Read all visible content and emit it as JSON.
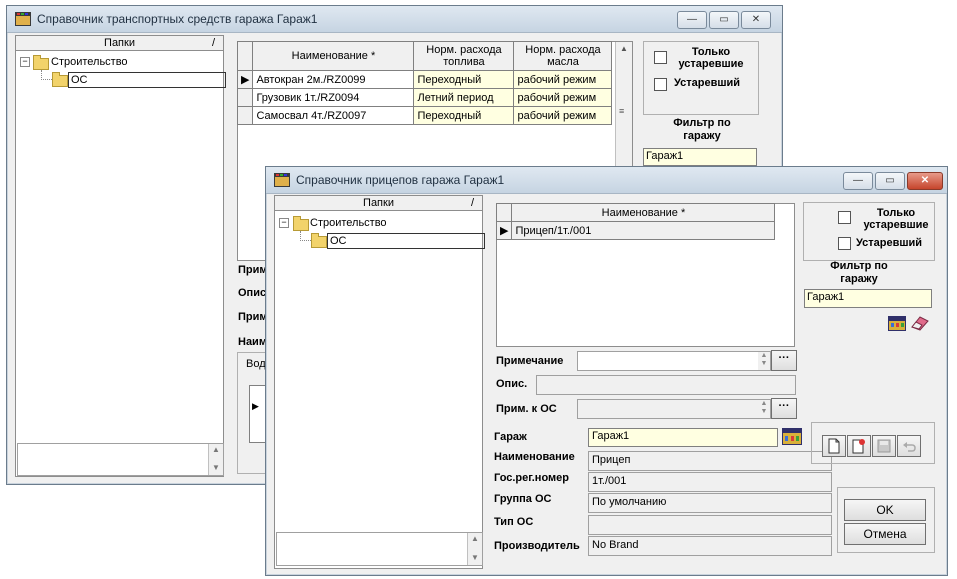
{
  "back_window": {
    "title": "Справочник транспортных средств гаража Гараж1",
    "folders_header": "Папки",
    "tree_root": "Строительство",
    "tree_child": "ОС",
    "columns": [
      "Наименование *",
      "Норм. расхода топлива",
      "Норм. расхода масла"
    ],
    "rows": [
      {
        "name": "Автокран 2м./RZ0099",
        "fuel": "Переходный",
        "oil": "рабочий режим",
        "current": true
      },
      {
        "name": "Грузовик 1т./RZ0094",
        "fuel": "Летний период",
        "oil": "рабочий режим",
        "current": false
      },
      {
        "name": "Самосвал 4т./RZ0097",
        "fuel": "Переходный",
        "oil": "рабочий режим",
        "current": false
      }
    ],
    "only_outdated_label": "Только устаревшие",
    "outdated_label": "Устаревший",
    "filter_label": "Фильтр по гаражу",
    "filter_value": "Гараж1",
    "partial_labels": [
      "Прим",
      "Опис",
      "Прим",
      "Наим"
    ],
    "partial_group": "Водк"
  },
  "front_window": {
    "title": "Справочник прицепов гаража Гараж1",
    "folders_header": "Папки",
    "tree_root": "Строительство",
    "tree_child": "ОС",
    "column": "Наименование *",
    "rows": [
      {
        "name": "Прицеп/1т./001",
        "current": true
      }
    ],
    "only_outdated_label": "Только устаревшие",
    "outdated_label": "Устаревший",
    "filter_label": "Фильтр по гаражу",
    "filter_value": "Гараж1",
    "note_label": "Примечание",
    "desc_label": "Опис.",
    "os_note_label": "Прим. к ОС",
    "ellipsis": "···",
    "fields": {
      "garage_label": "Гараж",
      "garage_value": "Гараж1",
      "name_label": "Наименование",
      "name_value": "Прицеп",
      "reg_label": "Гос.рег.номер",
      "reg_value": "1т./001",
      "group_label": "Группа ОС",
      "group_value": "По умолчанию",
      "type_label": "Тип ОС",
      "type_value": "",
      "maker_label": "Производитель",
      "maker_value": "No Brand"
    },
    "ok_label": "OK",
    "cancel_label": "Отмена"
  },
  "colors": {
    "title_text": "#1f2f40",
    "highlight": "#ffffe1",
    "close": "#c6452c"
  },
  "icons": [
    "app-icon",
    "folder-icon",
    "minimize-icon",
    "maximize-icon",
    "close-icon",
    "garage-select-icon",
    "eraser-icon",
    "new-doc-icon",
    "copy-doc-icon",
    "save-icon",
    "undo-icon"
  ]
}
